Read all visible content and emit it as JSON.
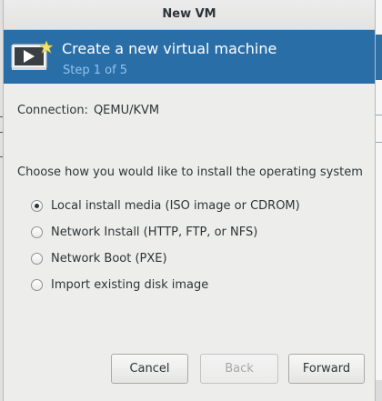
{
  "window": {
    "title": "New VM"
  },
  "banner": {
    "title": "Create a new virtual machine",
    "step": "Step 1 of 5",
    "icon": "virtual-machine-new-icon"
  },
  "connection": {
    "label": "Connection:",
    "value": "QEMU/KVM"
  },
  "install": {
    "prompt": "Choose how you would like to install the operating system",
    "options": [
      {
        "label": "Local install media (ISO image or CDROM)",
        "selected": true
      },
      {
        "label": "Network Install (HTTP, FTP, or NFS)",
        "selected": false
      },
      {
        "label": "Network Boot (PXE)",
        "selected": false
      },
      {
        "label": "Import existing disk image",
        "selected": false
      }
    ]
  },
  "buttons": {
    "cancel": "Cancel",
    "back": "Back",
    "forward": "Forward"
  },
  "colors": {
    "banner_bg": "#2a6ea7",
    "banner_subtitle": "#8fc3ee",
    "dialog_bg": "#ededec"
  }
}
